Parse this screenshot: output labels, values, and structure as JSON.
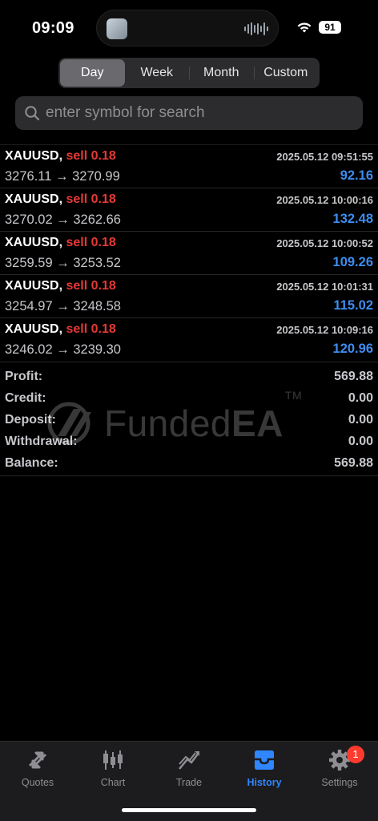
{
  "status": {
    "time": "09:09",
    "battery": "91"
  },
  "periods": [
    "Day",
    "Week",
    "Month",
    "Custom"
  ],
  "active_period": "Day",
  "search": {
    "placeholder": "enter symbol for search"
  },
  "deals": [
    {
      "symbol": "XAUUSD,",
      "side": "sell 0.18",
      "time": "2025.05.12 09:51:55",
      "open": "3276.11",
      "arrow": "→",
      "close": "3270.99",
      "profit": "92.16"
    },
    {
      "symbol": "XAUUSD,",
      "side": "sell 0.18",
      "time": "2025.05.12 10:00:16",
      "open": "3270.02",
      "arrow": "→",
      "close": "3262.66",
      "profit": "132.48"
    },
    {
      "symbol": "XAUUSD,",
      "side": "sell 0.18",
      "time": "2025.05.12 10:00:52",
      "open": "3259.59",
      "arrow": "→",
      "close": "3253.52",
      "profit": "109.26"
    },
    {
      "symbol": "XAUUSD,",
      "side": "sell 0.18",
      "time": "2025.05.12 10:01:31",
      "open": "3254.97",
      "arrow": "→",
      "close": "3248.58",
      "profit": "115.02"
    },
    {
      "symbol": "XAUUSD,",
      "side": "sell 0.18",
      "time": "2025.05.12 10:09:16",
      "open": "3246.02",
      "arrow": "→",
      "close": "3239.30",
      "profit": "120.96"
    }
  ],
  "summary": [
    {
      "label": "Profit:",
      "value": "569.88"
    },
    {
      "label": "Credit:",
      "value": "0.00"
    },
    {
      "label": "Deposit:",
      "value": "0.00"
    },
    {
      "label": "Withdrawal:",
      "value": "0.00"
    },
    {
      "label": "Balance:",
      "value": "569.88"
    }
  ],
  "watermark": {
    "text": "Funded",
    "text_bold": "EA",
    "tm": "TM"
  },
  "tabs": [
    {
      "label": "Quotes",
      "icon": "quotes-icon"
    },
    {
      "label": "Chart",
      "icon": "chart-icon"
    },
    {
      "label": "Trade",
      "icon": "trade-icon"
    },
    {
      "label": "History",
      "icon": "history-icon"
    },
    {
      "label": "Settings",
      "icon": "settings-icon",
      "badge": "1"
    }
  ],
  "active_tab": "History",
  "colors": {
    "sell": "#e53935",
    "profit": "#3d8cf0",
    "active_tab": "#2f86ff",
    "badge": "#ff3b30"
  }
}
